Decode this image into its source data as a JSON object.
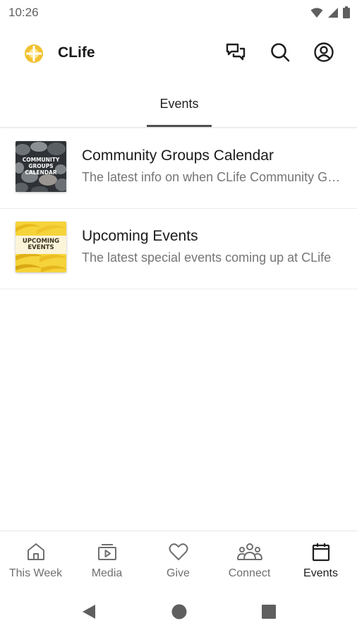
{
  "status_bar": {
    "time": "10:26"
  },
  "app_bar": {
    "title": "CLife"
  },
  "tabs": [
    {
      "label": "Events"
    }
  ],
  "events": [
    {
      "title": "Community Groups Calendar",
      "subtitle": "The latest info on when CLife Community Groups meet",
      "thumbnail_text": "Community Groups Calendar"
    },
    {
      "title": "Upcoming Events",
      "subtitle": "The latest special events coming up at CLife",
      "thumbnail_text": "Upcoming Events"
    }
  ],
  "bottom_nav": {
    "items": [
      {
        "label": "This Week",
        "icon": "home-icon"
      },
      {
        "label": "Media",
        "icon": "media-icon"
      },
      {
        "label": "Give",
        "icon": "heart-icon"
      },
      {
        "label": "Connect",
        "icon": "people-icon"
      },
      {
        "label": "Events",
        "icon": "calendar-icon"
      }
    ],
    "active": "Events"
  },
  "colors": {
    "logo_yellow": "#f2c230",
    "text_primary": "#1a1a1a",
    "text_secondary": "#757575",
    "tab_indicator": "#505050"
  }
}
